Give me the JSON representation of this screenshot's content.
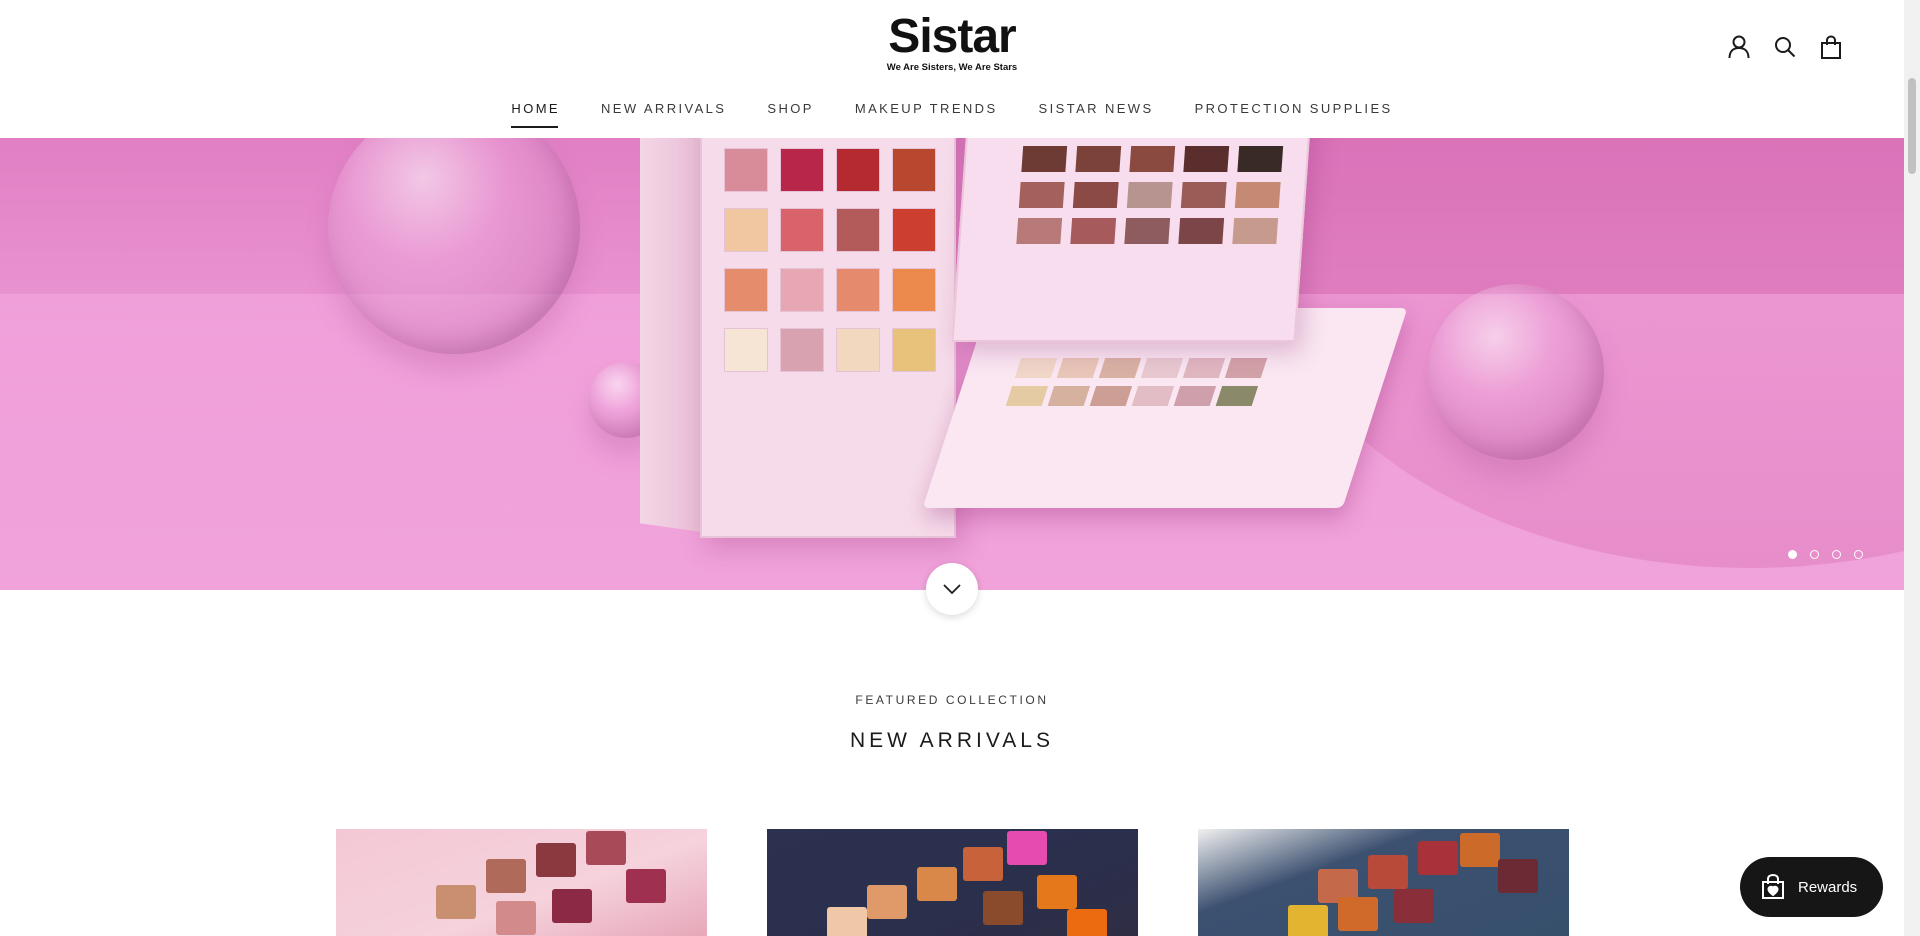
{
  "header": {
    "logo_word": "Sistar",
    "logo_tagline": "We Are Sisters, We Are Stars",
    "icons": [
      "account-icon",
      "search-icon",
      "cart-icon"
    ]
  },
  "nav": {
    "items": [
      {
        "label": "HOME",
        "active": true
      },
      {
        "label": "NEW ARRIVALS",
        "active": false
      },
      {
        "label": "SHOP",
        "active": false
      },
      {
        "label": "MAKEUP TRENDS",
        "active": false
      },
      {
        "label": "SISTAR NEWS",
        "active": false
      },
      {
        "label": "PROTECTION SUPPLIES",
        "active": false
      }
    ]
  },
  "hero": {
    "slide_count": 4,
    "active_slide": 1,
    "background_color": "#e890cf"
  },
  "featured": {
    "eyebrow": "FEATURED COLLECTION",
    "title": "NEW ARRIVALS"
  },
  "rewards": {
    "label": "Rewards"
  },
  "colors": {
    "text": "#1c1b1b",
    "rewards_bg": "#161616",
    "hero_pink": "#e890cf"
  }
}
